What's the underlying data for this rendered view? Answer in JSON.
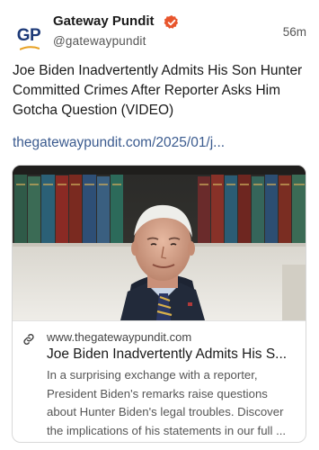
{
  "account": {
    "name": "Gateway Pundit",
    "handle": "@gatewaypundit",
    "avatar_text": "GP",
    "verified": true,
    "time": "56m"
  },
  "post": {
    "text": "Joe Biden Inadvertently Admits His Son Hunter Committed Crimes After Reporter Asks Him Gotcha Question (VIDEO)",
    "link_text": "thegatewaypundit.com/2025/01/j..."
  },
  "card": {
    "domain": "www.thegatewaypundit.com",
    "title": "Joe Biden Inadvertently Admits His S...",
    "description": "In a surprising exchange with a reporter, President Biden's remarks raise questions about Hunter Biden's legal troubles. Discover the implications of his statements in our full ..."
  },
  "colors": {
    "brand": "#1d3a78",
    "verified": "#e8552c",
    "link": "#3b5b8f"
  },
  "icons": {
    "verified": "verified-badge-icon",
    "link": "link-icon"
  }
}
